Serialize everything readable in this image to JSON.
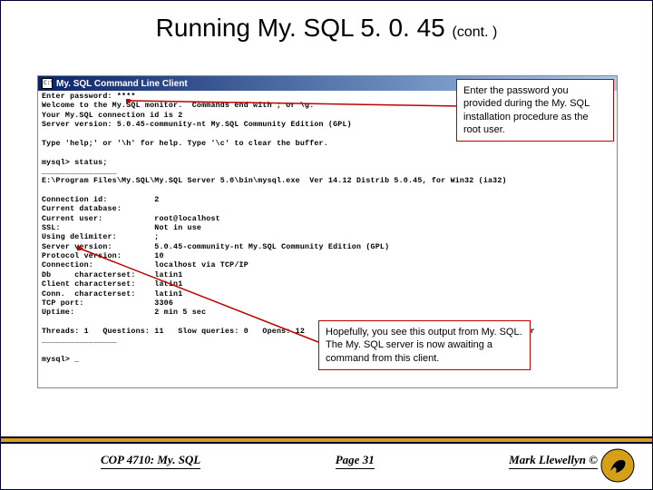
{
  "title_main": "Running My. SQL 5. 0. 45 ",
  "title_cont": "(cont. )",
  "titlebar_text": "My. SQL Command Line Client",
  "console_text": "Enter password: ****\nWelcome to the My.SQL monitor.  Commands end with ; or \\g.\nYour My.SQL connection id is 2\nServer version: 5.0.45-community-nt My.SQL Community Edition (GPL)\n\nType 'help;' or '\\h' for help. Type '\\c' to clear the buffer.\n\nmysql> status;\n________________\nE:\\Program Files\\My.SQL\\My.SQL Server 5.0\\bin\\mysql.exe  Ver 14.12 Distrib 5.0.45, for Win32 (ia32)\n\nConnection id:          2\nCurrent database:\nCurrent user:           root@localhost\nSSL:                    Not in use\nUsing delimiter:        ;\nServer version:         5.0.45-community-nt My.SQL Community Edition (GPL)\nProtocol version:       10\nConnection:             localhost via TCP/IP\nDb     characterset:    latin1\nClient characterset:    latin1\nConn.  characterset:    latin1\nTCP port:               3306\nUptime:                 2 min 5 sec\n\nThreads: 1   Questions: 11   Slow queries: 0   Opens: 12   Flush tables: 1   Open tables: 6   Queries per \n________________\n\nmysql> _",
  "callout1": "Enter the password you provided during the My. SQL installation procedure as the root user.",
  "callout2": "Hopefully, you see this output from My. SQL.  The My. SQL server is now awaiting a command from this client.",
  "footer": {
    "left": "COP 4710: My. SQL",
    "center": "Page 31",
    "right": "Mark Llewellyn ©"
  }
}
